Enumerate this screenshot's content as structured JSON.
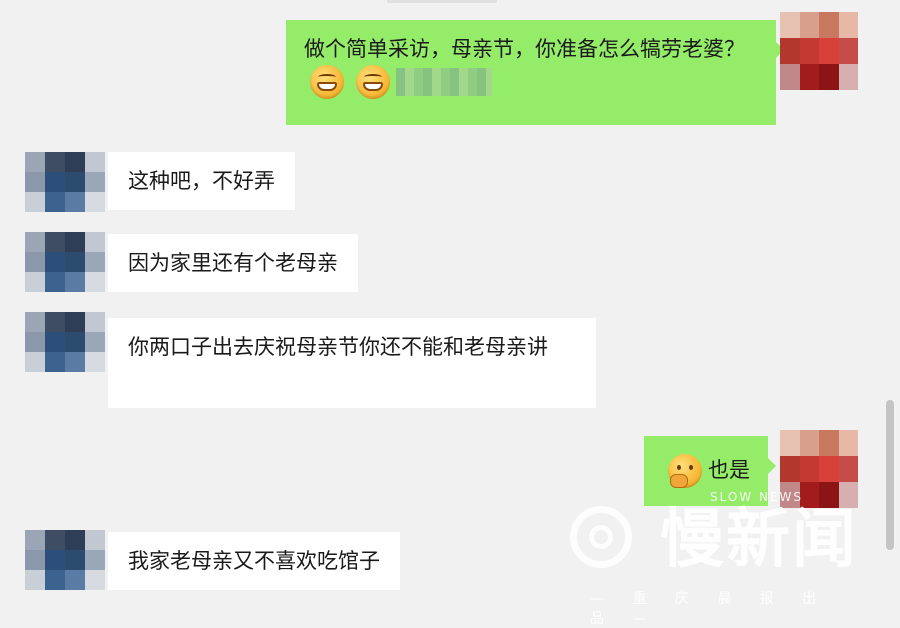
{
  "messages": [
    {
      "side": "out",
      "segments": [
        {
          "text": "做个简单采访，母亲节，你准备怎么犒劳老婆？"
        },
        {
          "emoji": "grin-icon"
        },
        {
          "emoji": "grin-icon"
        },
        {
          "blurred": true
        }
      ]
    },
    {
      "side": "in",
      "text": "这种吧，不好弄"
    },
    {
      "side": "in",
      "text": "因为家里还有个老母亲"
    },
    {
      "side": "in",
      "text": "你两口子出去庆祝母亲节你还不能和老母亲讲"
    },
    {
      "side": "out",
      "segments": [
        {
          "emoji": "think-icon"
        },
        {
          "text": "也是"
        }
      ]
    },
    {
      "side": "in",
      "text": "我家老母亲又不喜欢吃馆子"
    }
  ],
  "watermark": {
    "brand_en": "SLOW NEWS",
    "brand_cn": "慢新闻",
    "tagline": "— 重 庆 晨 报 出 品 —"
  },
  "colors": {
    "background": "#f1f1f1",
    "incoming_bubble": "#ffffff",
    "outgoing_bubble": "#95ec69",
    "text": "#1a1a1a"
  }
}
